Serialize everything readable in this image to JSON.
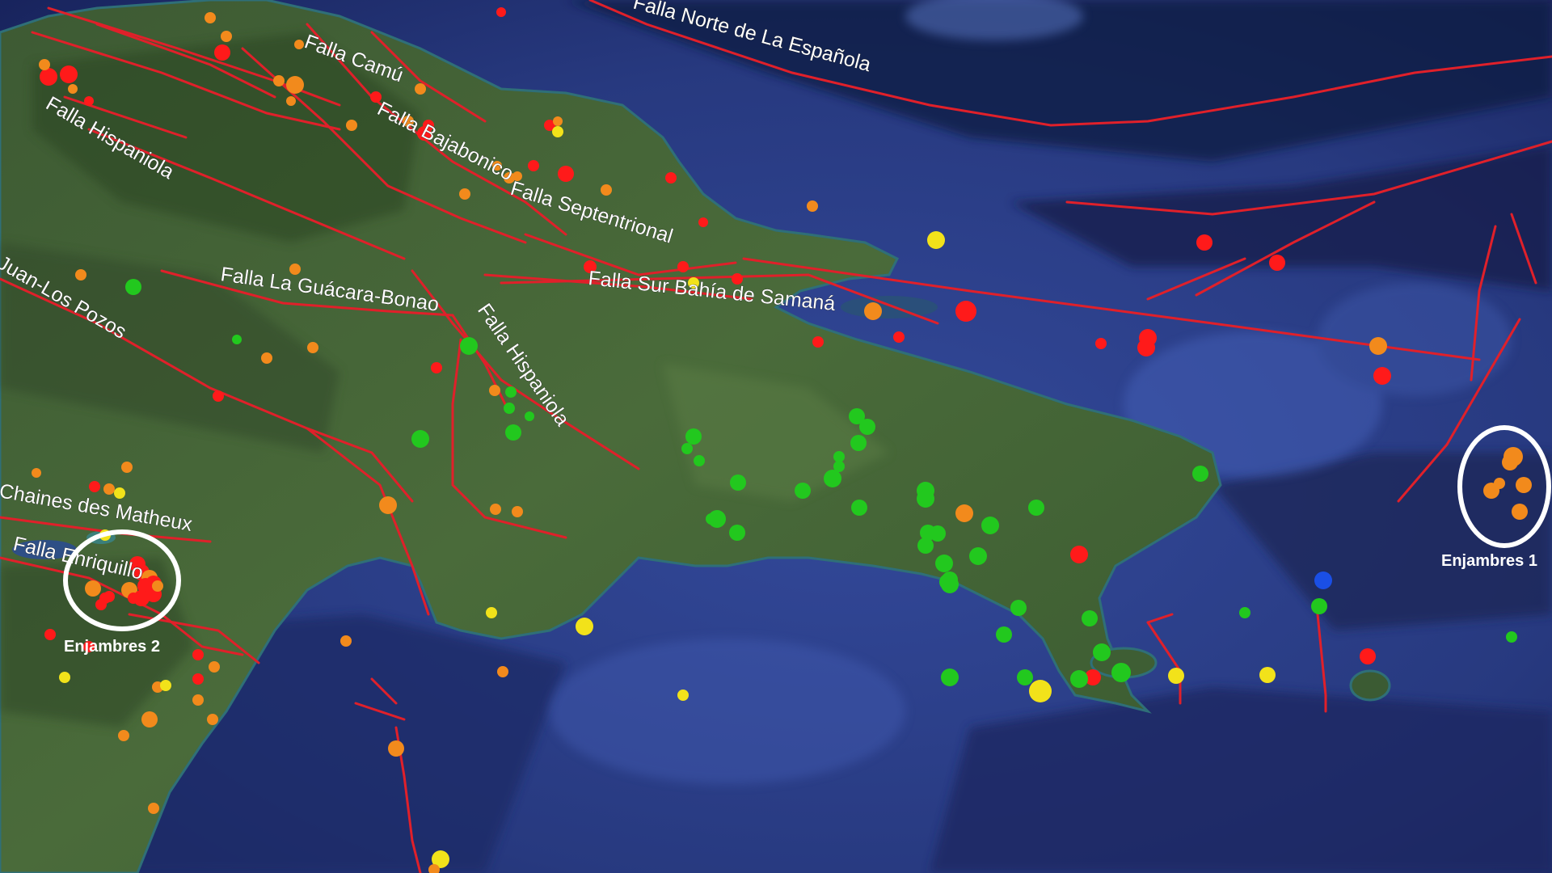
{
  "colors": {
    "ocean": "#2a3f8a",
    "ocean_deep": "#15204e",
    "land": "#3f6236",
    "fault": "#e0202a",
    "swarm_ring": "#ffffff",
    "mag_red": "#ff1a1a",
    "mag_orange": "#f28a1c",
    "mag_yellow": "#f2e21a",
    "mag_green": "#22c81e",
    "mag_blue": "#1a4fe6"
  },
  "fault_labels": [
    "Falla Norte de La Española",
    "Falla Camú",
    "Falla Bajabonico",
    "Falla Hispaniola",
    "Falla Septentrional",
    "Falla Sur Bahía de Samaná",
    "Falla La Guácara-Bonao",
    "Juan-Los Pozos",
    "Falla Hispaniola",
    "Chaines des Matheux",
    "Falla Enriquillo"
  ],
  "swarm_labels": [
    "Enjambres 1",
    "Enjambres 2"
  ],
  "event_categories": [
    "red",
    "orange",
    "yellow",
    "green",
    "blue"
  ]
}
